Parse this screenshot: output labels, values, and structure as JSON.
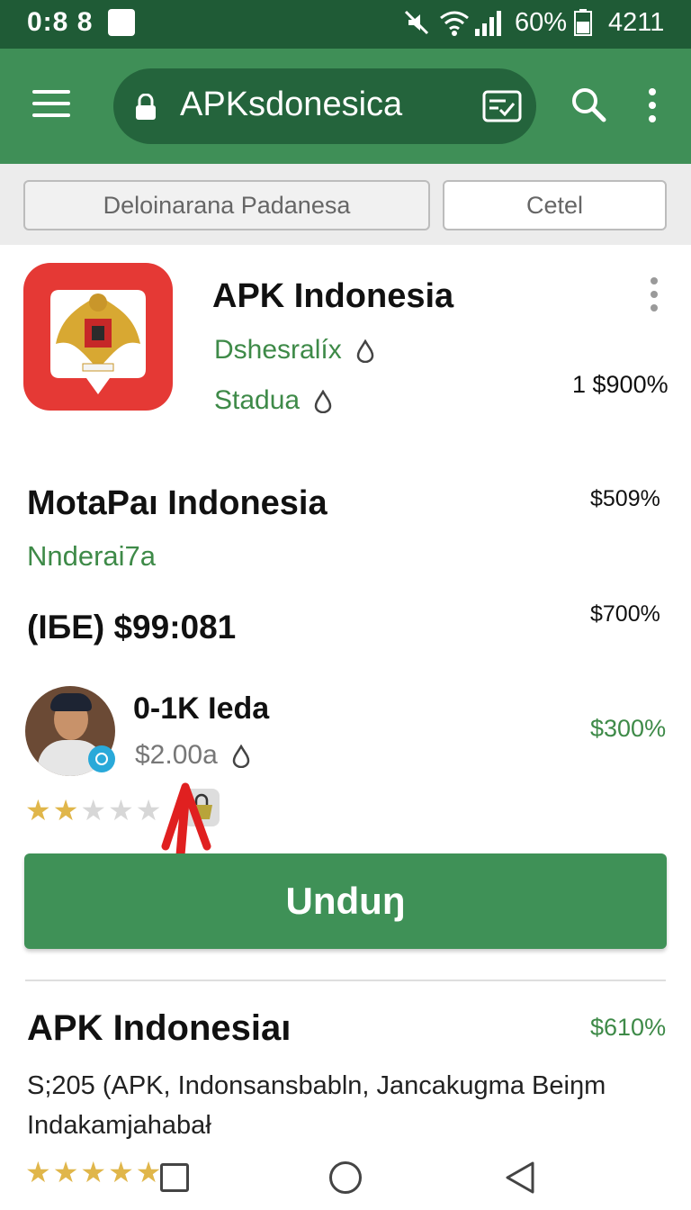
{
  "status_bar": {
    "time": "0:8 8",
    "battery_percent": "60%",
    "clock": "4211",
    "icons": [
      "notification-icon",
      "mute-icon",
      "wifi-icon",
      "signal-icon",
      "battery-icon"
    ]
  },
  "browser": {
    "url": "APKsdonesica",
    "icons": [
      "menu-icon",
      "lock-icon",
      "tabs-icon",
      "search-icon",
      "more-icon"
    ]
  },
  "chips": [
    "Deloinarana Padanesa",
    "Cetel"
  ],
  "app": {
    "title": "APK Indonesia",
    "developer": "Dshesralíx",
    "category": "Stadua",
    "price_right": "1 $900%"
  },
  "section": {
    "title": "MotaPaı Indonesia",
    "subtitle": "Nnderai7a",
    "price_right": "$509%",
    "size_line": "(IБE) $99:081",
    "size_price": "$700%"
  },
  "publisher": {
    "name": "0-1K Ieda",
    "price": "$2.00a",
    "price_right": "$300%",
    "rating_stars": 2,
    "rating_max": 5
  },
  "download_button": "Unduŋ",
  "app2": {
    "title": "APK Indonesiaı",
    "price_right": "$610%",
    "description_line1": "S;205 (APK, Indonsansbabln, Jancakugma Beiŋm",
    "description_line2": "Indakamjahabał",
    "rating_stars": 5,
    "rating_max": 5
  },
  "colors": {
    "status_bar": "#1f5b36",
    "app_bar": "#3f8f57",
    "accent_green": "#3e8a48",
    "button": "#3f9157",
    "app_icon_bg": "#e53935",
    "annotation_arrow": "#e02020"
  }
}
